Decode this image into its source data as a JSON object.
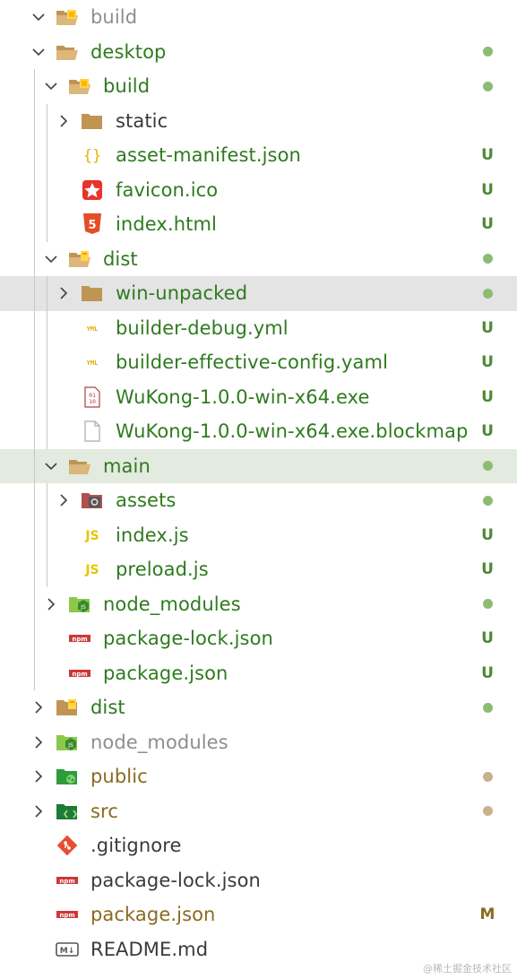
{
  "explorer": {
    "items": [
      {
        "label": "build",
        "depth": 0,
        "kind": "folder-open",
        "icon": "build-folder-open-icon",
        "chevron": "down",
        "color": "#8e8e8e",
        "status": "none"
      },
      {
        "label": "desktop",
        "depth": 0,
        "kind": "folder-open",
        "icon": "folder-open-icon",
        "chevron": "down",
        "color": "#2f7a1f",
        "status": "dot",
        "status_color": "#8cbc73"
      },
      {
        "label": "build",
        "depth": 1,
        "kind": "folder-open",
        "icon": "build-folder-open-icon",
        "chevron": "down",
        "color": "#2f7a1f",
        "status": "dot",
        "status_color": "#8cbc73"
      },
      {
        "label": "static",
        "depth": 2,
        "kind": "folder",
        "icon": "folder-icon",
        "chevron": "right",
        "color": "#3a3a3a",
        "status": "none"
      },
      {
        "label": "asset-manifest.json",
        "depth": 2,
        "kind": "file",
        "icon": "json-icon",
        "chevron": "none",
        "color": "#2f7a1f",
        "status": "text",
        "status_text": "U",
        "status_color": "#4e8a35"
      },
      {
        "label": "favicon.ico",
        "depth": 2,
        "kind": "file",
        "icon": "favicon-star-icon",
        "chevron": "none",
        "color": "#2f7a1f",
        "status": "text",
        "status_text": "U",
        "status_color": "#4e8a35"
      },
      {
        "label": "index.html",
        "depth": 2,
        "kind": "file",
        "icon": "html5-icon",
        "chevron": "none",
        "color": "#2f7a1f",
        "status": "text",
        "status_text": "U",
        "status_color": "#4e8a35"
      },
      {
        "label": "dist",
        "depth": 1,
        "kind": "folder-open",
        "icon": "dist-folder-open-icon",
        "chevron": "down",
        "color": "#2f7a1f",
        "status": "dot",
        "status_color": "#8cbc73"
      },
      {
        "label": "win-unpacked",
        "depth": 2,
        "kind": "folder",
        "icon": "folder-icon",
        "chevron": "right",
        "color": "#2f7a1f",
        "status": "dot",
        "status_color": "#8cbc73",
        "highlight": "hl-grey"
      },
      {
        "label": "builder-debug.yml",
        "depth": 2,
        "kind": "file",
        "icon": "yaml-icon",
        "chevron": "none",
        "color": "#2f7a1f",
        "status": "text",
        "status_text": "U",
        "status_color": "#4e8a35"
      },
      {
        "label": "builder-effective-config.yaml",
        "depth": 2,
        "kind": "file",
        "icon": "yaml-icon",
        "chevron": "none",
        "color": "#2f7a1f",
        "status": "text",
        "status_text": "U",
        "status_color": "#4e8a35"
      },
      {
        "label": "WuKong-1.0.0-win-x64.exe",
        "depth": 2,
        "kind": "file",
        "icon": "binary-exe-icon",
        "chevron": "none",
        "color": "#2f7a1f",
        "status": "text",
        "status_text": "U",
        "status_color": "#4e8a35"
      },
      {
        "label": "WuKong-1.0.0-win-x64.exe.blockmap",
        "depth": 2,
        "kind": "file",
        "icon": "blank-file-icon",
        "chevron": "none",
        "color": "#2f7a1f",
        "status": "text",
        "status_text": "U",
        "status_color": "#4e8a35"
      },
      {
        "label": "main",
        "depth": 1,
        "kind": "folder-open",
        "icon": "folder-open-icon",
        "chevron": "down",
        "color": "#2f7a1f",
        "status": "dot",
        "status_color": "#8cbc73",
        "highlight": "hl-green"
      },
      {
        "label": "assets",
        "depth": 2,
        "kind": "folder",
        "icon": "assets-folder-icon",
        "chevron": "right",
        "color": "#2f7a1f",
        "status": "dot",
        "status_color": "#8cbc73"
      },
      {
        "label": "index.js",
        "depth": 2,
        "kind": "file",
        "icon": "js-icon",
        "chevron": "none",
        "color": "#2f7a1f",
        "status": "text",
        "status_text": "U",
        "status_color": "#4e8a35"
      },
      {
        "label": "preload.js",
        "depth": 2,
        "kind": "file",
        "icon": "js-icon",
        "chevron": "none",
        "color": "#2f7a1f",
        "status": "text",
        "status_text": "U",
        "status_color": "#4e8a35"
      },
      {
        "label": "node_modules",
        "depth": 1,
        "kind": "folder",
        "icon": "nodejs-folder-icon",
        "chevron": "right",
        "color": "#2f7a1f",
        "status": "dot",
        "status_color": "#8cbc73"
      },
      {
        "label": "package-lock.json",
        "depth": 1,
        "kind": "file",
        "icon": "npm-icon",
        "chevron": "none",
        "color": "#2f7a1f",
        "status": "text",
        "status_text": "U",
        "status_color": "#4e8a35"
      },
      {
        "label": "package.json",
        "depth": 1,
        "kind": "file",
        "icon": "npm-icon",
        "chevron": "none",
        "color": "#2f7a1f",
        "status": "text",
        "status_text": "U",
        "status_color": "#4e8a35"
      },
      {
        "label": "dist",
        "depth": 0,
        "kind": "folder",
        "icon": "dist-folder-icon",
        "chevron": "right",
        "color": "#2f7a1f",
        "status": "dot",
        "status_color": "#8cbc73"
      },
      {
        "label": "node_modules",
        "depth": 0,
        "kind": "folder",
        "icon": "nodejs-folder-icon",
        "chevron": "right",
        "color": "#8e8e8e",
        "status": "none"
      },
      {
        "label": "public",
        "depth": 0,
        "kind": "folder",
        "icon": "public-folder-icon",
        "chevron": "right",
        "color": "#8a6a20",
        "status": "dot",
        "status_color": "#c8b289"
      },
      {
        "label": "src",
        "depth": 0,
        "kind": "folder",
        "icon": "src-folder-icon",
        "chevron": "right",
        "color": "#8a6a20",
        "status": "dot",
        "status_color": "#c8b289"
      },
      {
        "label": ".gitignore",
        "depth": 0,
        "kind": "file",
        "icon": "git-icon",
        "chevron": "none",
        "color": "#3a3a3a",
        "status": "none"
      },
      {
        "label": "package-lock.json",
        "depth": 0,
        "kind": "file",
        "icon": "npm-icon",
        "chevron": "none",
        "color": "#3a3a3a",
        "status": "none"
      },
      {
        "label": "package.json",
        "depth": 0,
        "kind": "file",
        "icon": "npm-icon",
        "chevron": "none",
        "color": "#8a6a20",
        "status": "text",
        "status_text": "M",
        "status_color": "#8a6a20"
      },
      {
        "label": "README.md",
        "depth": 0,
        "kind": "file",
        "icon": "markdown-icon",
        "chevron": "none",
        "color": "#3a3a3a",
        "status": "none"
      }
    ]
  },
  "watermark": "@稀土掘金技术社区"
}
